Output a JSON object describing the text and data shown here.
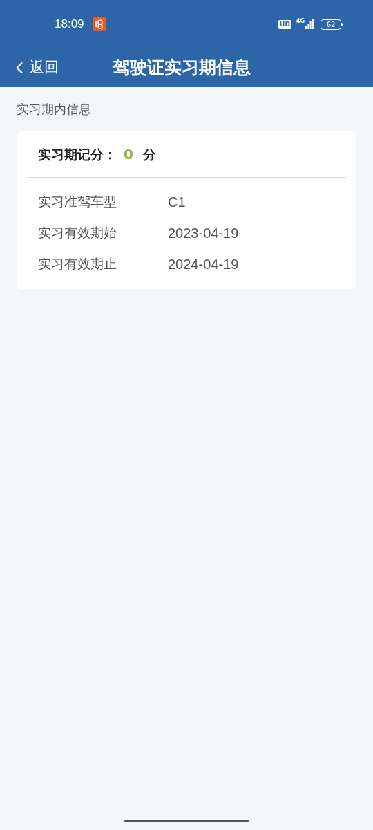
{
  "status_bar": {
    "time": "18:09",
    "hd": "HD",
    "network": "4G",
    "battery": "62"
  },
  "nav": {
    "back": "返回",
    "title": "驾驶证实习期信息"
  },
  "section_title": "实习期内信息",
  "score": {
    "label": "实习期记分：",
    "value": "0",
    "unit": "分"
  },
  "rows": [
    {
      "label": "实习准驾车型",
      "value": "C1"
    },
    {
      "label": "实习有效期始",
      "value": "2023-04-19"
    },
    {
      "label": "实习有效期止",
      "value": "2024-04-19"
    }
  ]
}
